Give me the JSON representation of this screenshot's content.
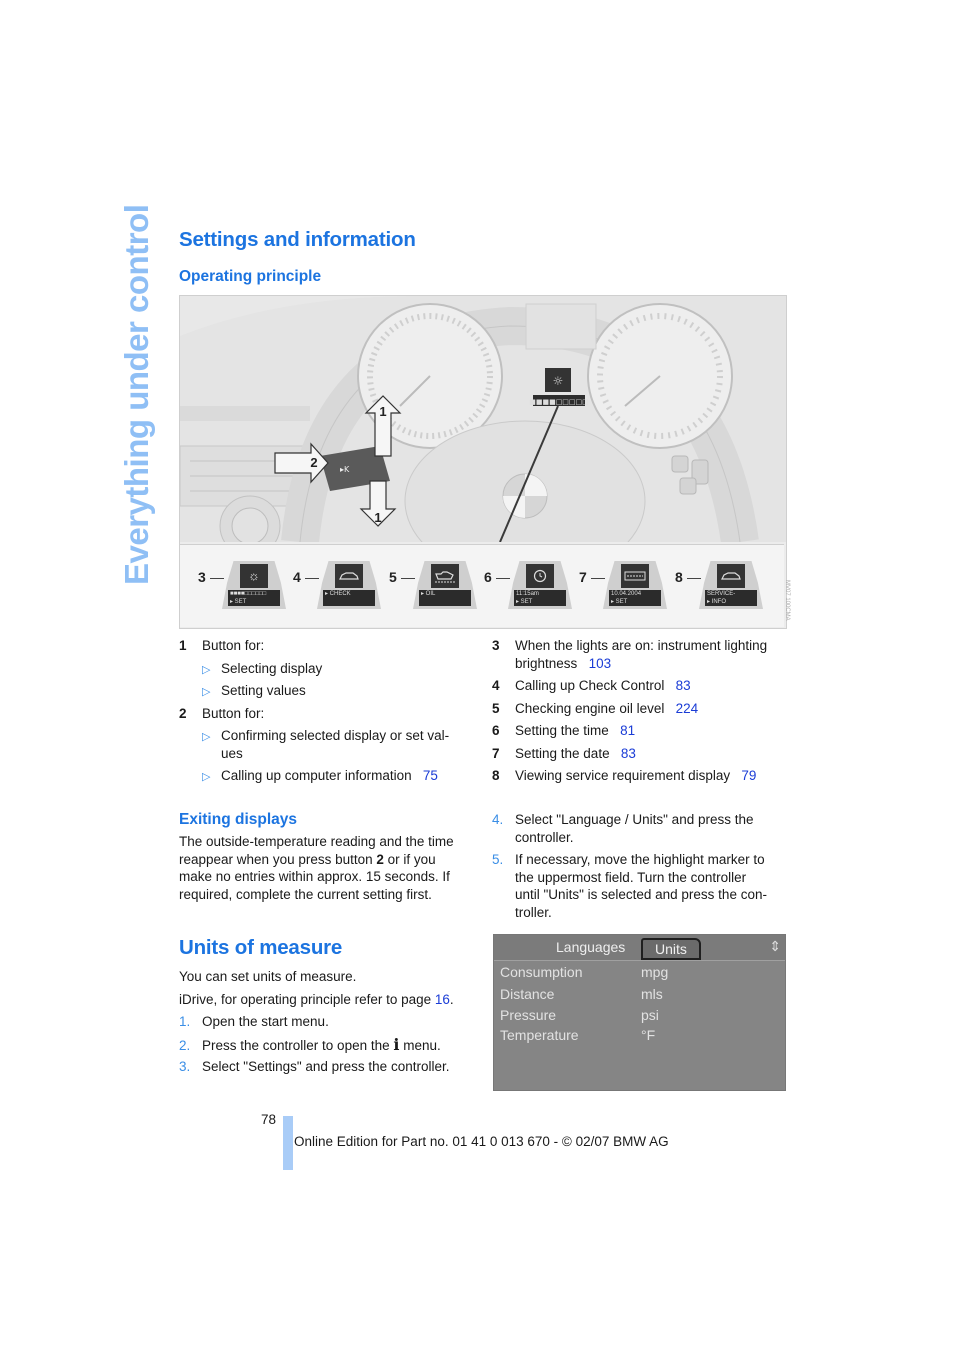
{
  "side_title": "Everything under control",
  "section1": {
    "title": "Settings and information",
    "subtitle": "Operating principle"
  },
  "figure": {
    "arrow_labels": [
      "1",
      "2",
      "1"
    ],
    "displays": [
      {
        "num": "3",
        "icon": "brightness-icon",
        "glyph": "☼",
        "text1": "■■■■□□□□□□",
        "text2": "▸ SET"
      },
      {
        "num": "4",
        "icon": "car-icon",
        "glyph": "🚗",
        "text1": "",
        "text2": "▸ CHECK"
      },
      {
        "num": "5",
        "icon": "oil-can-icon",
        "glyph": "🛢",
        "text1": "",
        "text2": "▸ OIL"
      },
      {
        "num": "6",
        "icon": "clock-icon",
        "glyph": "◷",
        "text1": "11:15am",
        "text2": "▸ SET"
      },
      {
        "num": "7",
        "icon": "calendar-icon",
        "glyph": "▦",
        "text1": "10.04.2004",
        "text2": "▸ SET"
      },
      {
        "num": "8",
        "icon": "car-icon",
        "glyph": "🚗",
        "text1": "SERVICE-",
        "text2": "▸ INFO"
      }
    ],
    "code": "MV07 100CMA"
  },
  "left_legend": [
    {
      "num": "1",
      "text": "Button for:"
    },
    {
      "bullet": "▷",
      "text": "Selecting display"
    },
    {
      "bullet": "▷",
      "text": "Setting values"
    },
    {
      "num": "2",
      "text": "Button for:"
    },
    {
      "bullet": "▷",
      "text": "Confirming selected display or set val-"
    },
    {
      "cont": true,
      "text": "ues"
    },
    {
      "bullet": "▷",
      "text": "Calling up computer information",
      "page": "75"
    }
  ],
  "right_legend": [
    {
      "num": "3",
      "text": "When the lights are on: instrument lighting",
      "text2": "brightness",
      "page": "103"
    },
    {
      "num": "4",
      "text": "Calling up Check Control",
      "page": "83"
    },
    {
      "num": "5",
      "text": "Checking engine oil level",
      "page": "224"
    },
    {
      "num": "6",
      "text": "Setting the time",
      "page": "81"
    },
    {
      "num": "7",
      "text": "Setting the date",
      "page": "83"
    },
    {
      "num": "8",
      "text": "Viewing service requirement display",
      "page": "79"
    }
  ],
  "exiting": {
    "title": "Exiting displays",
    "lines": [
      "The outside-temperature reading and the time",
      "reappear when you press button ",
      "2",
      " or if you",
      "make no entries within approx. 15 seconds. If",
      "required, complete the current setting first."
    ]
  },
  "units": {
    "title": "Units of measure",
    "intro": "You can set units of measure.",
    "idrive_text": "iDrive, for operating principle refer to page ",
    "idrive_page": "16",
    "steps": [
      {
        "n": "1.",
        "text": "Open the start menu."
      },
      {
        "n": "2.",
        "text_a": "Press the controller to open the ",
        "icon": "i",
        "text_b": " menu."
      },
      {
        "n": "3.",
        "text": "Select \"Settings\" and press the controller."
      },
      {
        "n": "4.",
        "lines": [
          "Select \"Language / Units\" and press the",
          "controller."
        ]
      },
      {
        "n": "5.",
        "lines": [
          "If necessary, move the highlight marker to",
          "the uppermost field. Turn the controller",
          "until \"Units\" is selected and press the con-",
          "troller."
        ]
      }
    ],
    "screen": {
      "tab_languages": "Languages",
      "tab_units": "Units",
      "rows": [
        {
          "label": "Consumption",
          "value": "mpg"
        },
        {
          "label": "Distance",
          "value": "mls"
        },
        {
          "label": "Pressure",
          "value": "psi"
        },
        {
          "label": "Temperature",
          "value": "°F"
        }
      ]
    }
  },
  "footer": {
    "page_number": "78",
    "text": "Online Edition for Part no. 01 41 0 013 670 - © 02/07 BMW AG"
  }
}
